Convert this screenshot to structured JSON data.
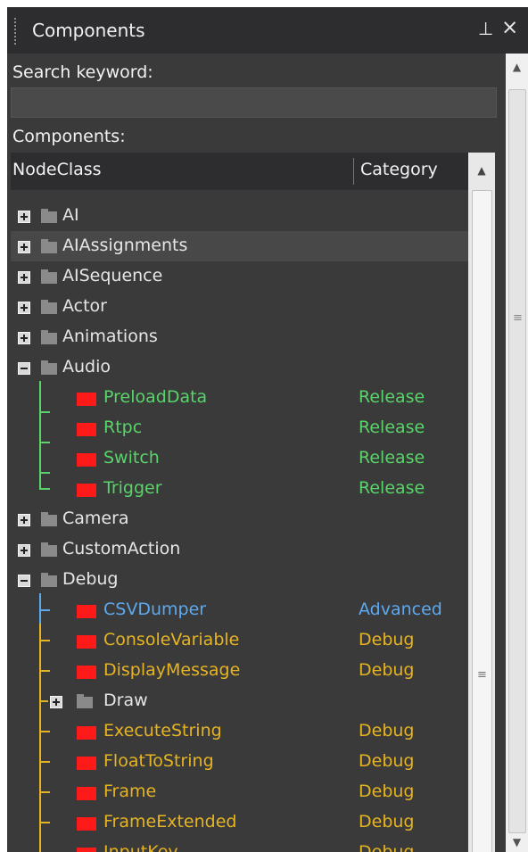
{
  "window": {
    "title": "Components"
  },
  "search": {
    "label": "Search keyword:",
    "value": ""
  },
  "components_label": "Components:",
  "columns": {
    "nodeclass": "NodeClass",
    "category": "Category"
  },
  "colors": {
    "release": "#59d46a",
    "advanced": "#5da9f0",
    "debug": "#e6b422",
    "folder_text": "#e6e6e6",
    "node_marker": "#ff1a1a"
  },
  "tree": {
    "ai": "AI",
    "ai_assignments": "AIAssignments",
    "ai_sequence": "AISequence",
    "actor": "Actor",
    "animations": "Animations",
    "audio": "Audio",
    "audio_items": [
      {
        "name": "PreloadData",
        "category": "Release"
      },
      {
        "name": "Rtpc",
        "category": "Release"
      },
      {
        "name": "Switch",
        "category": "Release"
      },
      {
        "name": "Trigger",
        "category": "Release"
      }
    ],
    "camera": "Camera",
    "custom_action": "CustomAction",
    "debug": "Debug",
    "debug_items": [
      {
        "name": "CSVDumper",
        "category": "Advanced"
      },
      {
        "name": "ConsoleVariable",
        "category": "Debug"
      },
      {
        "name": "DisplayMessage",
        "category": "Debug"
      },
      {
        "name": "ExecuteString",
        "category": "Debug"
      },
      {
        "name": "FloatToString",
        "category": "Debug"
      },
      {
        "name": "Frame",
        "category": "Debug"
      },
      {
        "name": "FrameExtended",
        "category": "Debug"
      },
      {
        "name": "InputKey",
        "category": "Debug"
      }
    ],
    "draw": "Draw"
  }
}
